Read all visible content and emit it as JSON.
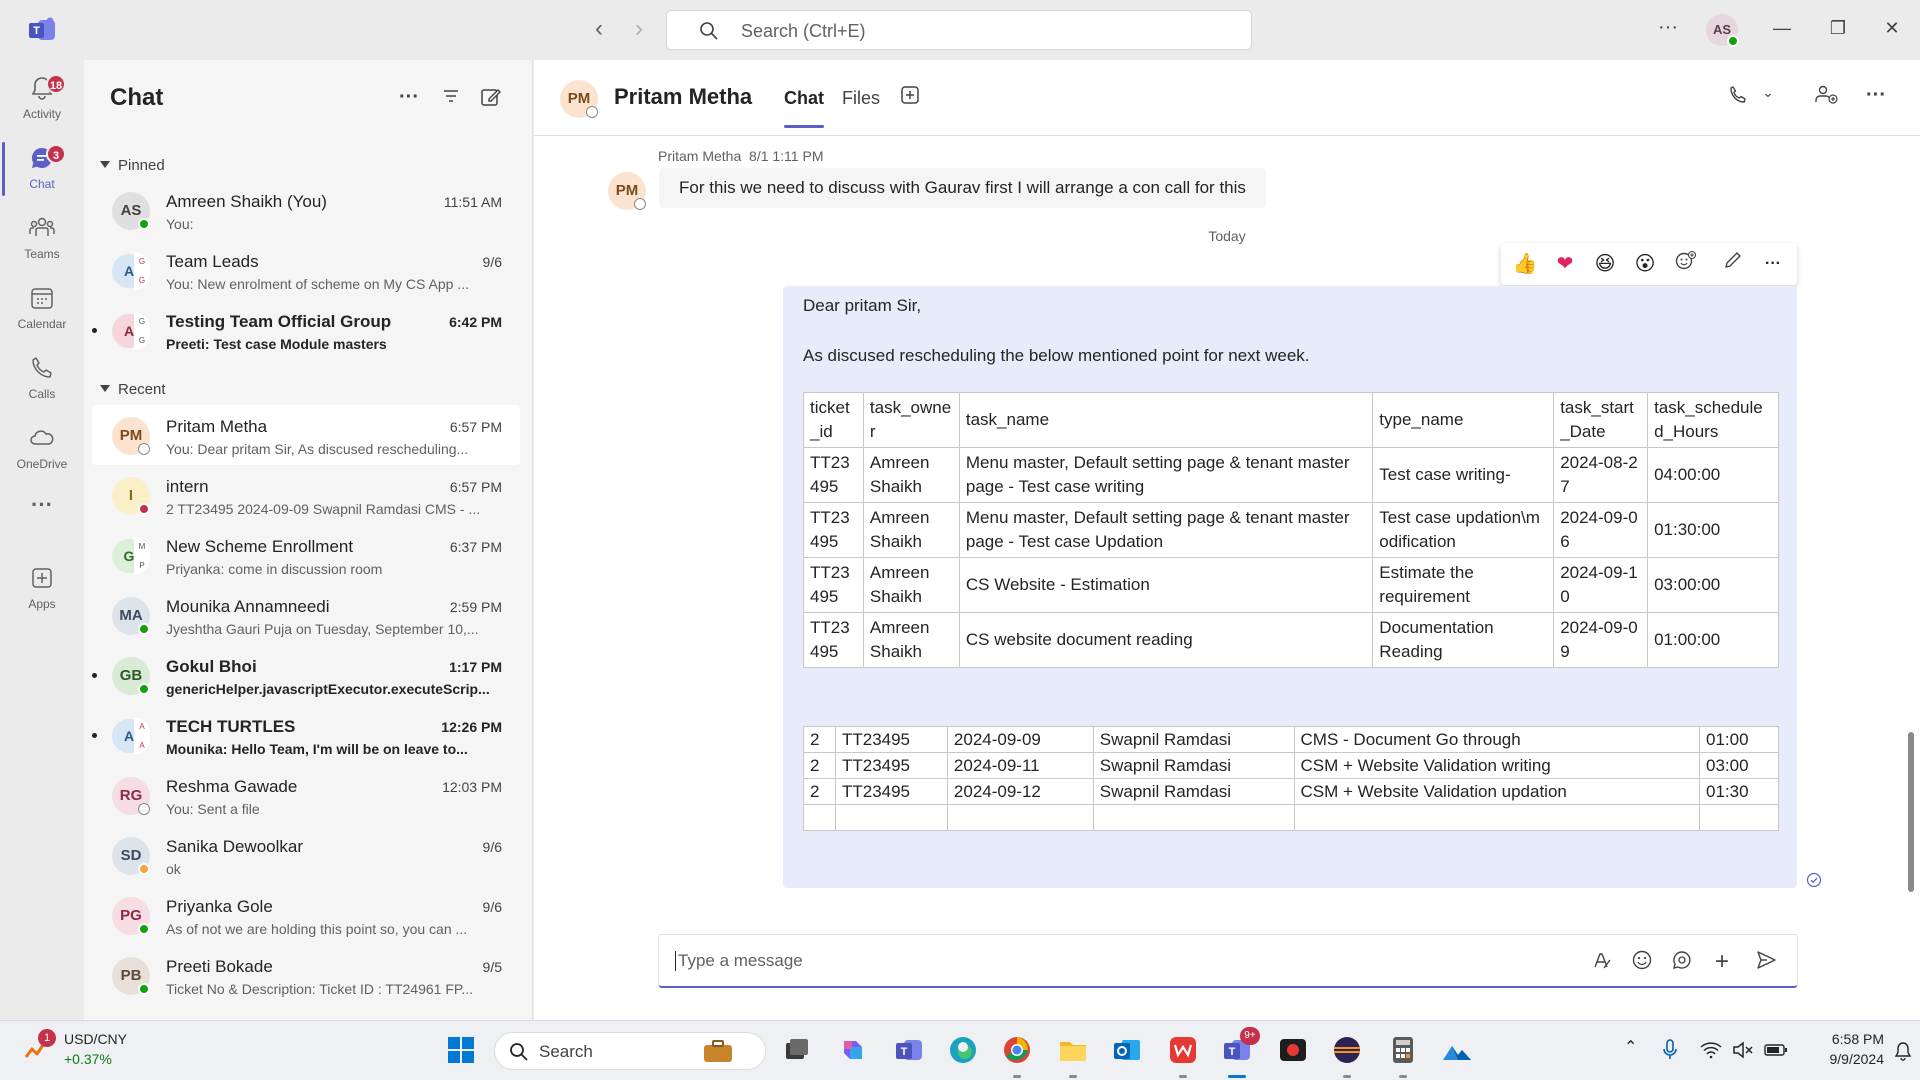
{
  "topbar": {
    "search_placeholder": "Search (Ctrl+E)",
    "user_initials": "AS"
  },
  "rail": {
    "items": [
      {
        "label": "Activity",
        "badge": "18"
      },
      {
        "label": "Chat",
        "badge": "3"
      },
      {
        "label": "Teams"
      },
      {
        "label": "Calendar"
      },
      {
        "label": "Calls"
      },
      {
        "label": "OneDrive"
      },
      {
        "label": "Apps"
      }
    ]
  },
  "chatlist": {
    "title": "Chat",
    "pinned_label": "Pinned",
    "recent_label": "Recent",
    "pinned": [
      {
        "initials": "AS",
        "name": "Amreen Shaikh (You)",
        "time": "11:51 AM",
        "preview": "You:"
      },
      {
        "initials": "A",
        "name": "Team Leads",
        "time": "9/6",
        "preview": "You: New enrolment of scheme on My CS App ..."
      },
      {
        "initials": "A",
        "name": "Testing Team Official Group",
        "time": "6:42 PM",
        "preview": "Preeti: Test case Module masters"
      }
    ],
    "recent": [
      {
        "initials": "PM",
        "name": "Pritam Metha",
        "time": "6:57 PM",
        "preview": "You: Dear pritam Sir,   As discused rescheduling..."
      },
      {
        "initials": "I",
        "name": "intern",
        "time": "6:57 PM",
        "preview": "2 TT23495 2024-09-09 Swapnil Ramdasi CMS - ..."
      },
      {
        "initials": "G",
        "name": "New Scheme Enrollment",
        "time": "6:37 PM",
        "preview": "Priyanka: come in discussion room"
      },
      {
        "initials": "MA",
        "name": "Mounika Annamneedi",
        "time": "2:59 PM",
        "preview": "Jyeshtha Gauri Puja on Tuesday, September 10,..."
      },
      {
        "initials": "GB",
        "name": "Gokul Bhoi",
        "time": "1:17 PM",
        "preview": "genericHelper.javascriptExecutor.executeScrip..."
      },
      {
        "initials": "A",
        "name": "TECH TURTLES",
        "time": "12:26 PM",
        "preview": "Mounika: Hello Team,   I'm will be on leave to..."
      },
      {
        "initials": "RG",
        "name": "Reshma Gawade",
        "time": "12:03 PM",
        "preview": "You: Sent a file"
      },
      {
        "initials": "SD",
        "name": "Sanika Dewoolkar",
        "time": "9/6",
        "preview": "ok"
      },
      {
        "initials": "PG",
        "name": "Priyanka Gole",
        "time": "9/6",
        "preview": "As of not we are holding this point so, you can ..."
      },
      {
        "initials": "PB",
        "name": "Preeti Bokade",
        "time": "9/5",
        "preview": "Ticket No & Description: Ticket ID : TT24961 FP..."
      }
    ]
  },
  "conversation": {
    "initials": "PM",
    "name": "Pritam Metha",
    "tabs": [
      "Chat",
      "Files"
    ],
    "prev_message": {
      "sender": "Pritam Metha",
      "time": "8/1 1:11 PM",
      "text": "For this we need to discuss with Gaurav first I will arrange a con call for this"
    },
    "day_separator": "Today",
    "outgoing": {
      "greeting": "Dear pritam Sir,",
      "intro": "As discused rescheduling the below mentioned point for next week.",
      "table1": {
        "headers": [
          "ticket_id",
          "task_owner",
          "task_name",
          "type_name",
          "task_start_Date",
          "task_scheduled_Hours"
        ],
        "rows": [
          [
            "TT23495",
            "Amreen Shaikh",
            "Menu master, Default setting page & tenant master page - Test case writing",
            "Test case writing-",
            "2024-08-27",
            "04:00:00"
          ],
          [
            "TT23495",
            "Amreen Shaikh",
            "Menu master, Default setting page & tenant master page - Test case Updation",
            "Test case updation\\modification",
            "2024-09-06",
            "01:30:00"
          ],
          [
            "TT23495",
            "Amreen Shaikh",
            "CS Website - Estimation",
            "Estimate the requirement",
            "2024-09-10",
            "03:00:00"
          ],
          [
            "TT23495",
            "Amreen Shaikh",
            "CS website document reading",
            "Documentation Reading",
            "2024-09-09",
            "01:00:00"
          ]
        ]
      },
      "table2": {
        "rows": [
          [
            "2",
            "TT23495",
            "2024-09-09",
            "Swapnil Ramdasi",
            "CMS - Document Go through",
            "01:00"
          ],
          [
            "2",
            "TT23495",
            "2024-09-11",
            "Swapnil Ramdasi",
            "CSM + Website Validation writing",
            "03:00"
          ],
          [
            "2",
            "TT23495",
            "2024-09-12",
            "Swapnil Ramdasi",
            "CSM + Website Validation updation",
            "01:30"
          ],
          [
            "",
            "",
            "",
            "",
            "",
            ""
          ]
        ]
      }
    },
    "composer_placeholder": "Type a message"
  },
  "taskbar": {
    "widget_title": "USD/CNY",
    "widget_value": "+0.37%",
    "widget_badge": "1",
    "search_label": "Search",
    "teams_badge": "9+",
    "time": "6:58 PM",
    "date": "9/9/2024"
  }
}
